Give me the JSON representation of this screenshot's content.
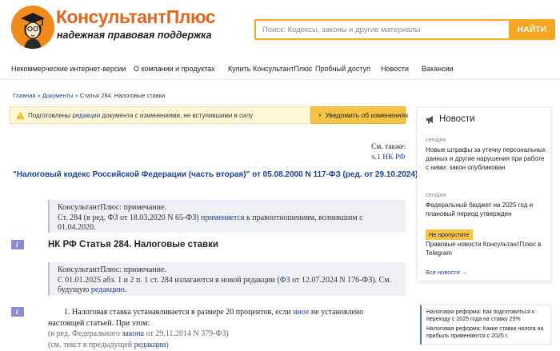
{
  "brand": {
    "title": "КонсультантПлюс",
    "subtitle": "надежная правовая поддержка"
  },
  "search": {
    "placeholder": "Поиск: Кодексы, законы и другие материалы",
    "button": "НАЙТИ"
  },
  "nav": [
    "Некоммерческие интернет-версии",
    "О компании и продуктах",
    "Купить КонсультантПлюс",
    "Пробный доступ",
    "Новости",
    "Вакансии"
  ],
  "breadcrumb": {
    "home": "Главная",
    "sep": " » ",
    "docs": "Документы",
    "current": "Статья 284. Налоговые ставки"
  },
  "notice": {
    "prefix": "Подготовлены ",
    "link": "редакции",
    "suffix": " документа с изменениями, не вступившими в силу",
    "notify_button": "Уведомить об изменениях"
  },
  "see_also": {
    "label": "См. также:",
    "link": "ч.1 НК РФ"
  },
  "doc_title": "\"Налоговый кодекс Российской Федерации (часть вторая)\" от 05.08.2000 N 117-ФЗ (ред. от 29.10.2024)",
  "note1": {
    "head": "КонсультантПлюс: примечание.",
    "line_a": "Ст. 284 (в ред. ФЗ от 18.03.2020 N 65-ФЗ) ",
    "link": "применяется",
    "line_b": " к правоотношениям, возникшим с",
    "line_c": "01.04.2020."
  },
  "article_title": "НК РФ Статья 284. Налоговые ставки",
  "note2": {
    "head": "КонсультантПлюс: примечание.",
    "line_a": "С 01.01.2025 абз. 1 и 2 п. 1 ст. 284 излагаются в новой редакции (",
    "link_a": "ФЗ",
    "line_b": " от 12.07.2024 N 176-ФЗ). См.",
    "line_c": "будущую ",
    "link_b": "редакцию",
    "line_d": "."
  },
  "body": {
    "p1_a": "1. Налоговая ставка устанавливается в размере 20 процентов, если ",
    "p1_link": "иное",
    "p1_b": " не установлено",
    "p1_c": "настоящей статьей. При этом:",
    "p2_a": "(в ред. Федерального ",
    "p2_link": "закона",
    "p2_b": " от 29.11.2014 N 379-ФЗ)",
    "p3_a": "(см. текст в предыдущей ",
    "p3_link": "редакции",
    "p3_b": ")"
  },
  "news": {
    "heading": "Новости",
    "items": [
      {
        "date": "сегодня",
        "text": "Новые штрафы за утечку персональных данных и другие нарушения при работе с ними: закон опубликован"
      },
      {
        "date": "сегодня",
        "text": "Федеральный бюджет на 2025 год и плановый период утвержден"
      },
      {
        "badge": "Не пропустите",
        "text": "Правовые новости КонсультантПлюс в Telegram"
      }
    ],
    "all": "Все новости →"
  },
  "reform": [
    "Налоговая реформа: Как подготовиться к переходу с 2025 года на ставку 25%",
    "Налоговая реформа: Какие ставки налога на прибыль применяются с 2025 г."
  ],
  "colors": {
    "brand_orange": "#e5661a",
    "accent_yellow": "#f5a623",
    "link_blue": "#1a3f9c"
  }
}
